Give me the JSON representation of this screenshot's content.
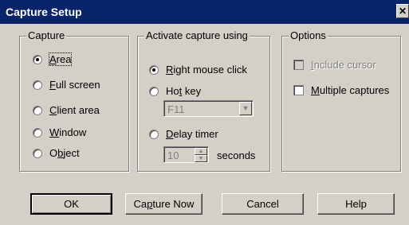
{
  "window": {
    "title": "Capture Setup",
    "close_glyph": "✕"
  },
  "capture_group": {
    "label": "Capture",
    "options": [
      {
        "pre": "",
        "key": "A",
        "post": "rea",
        "selected": true
      },
      {
        "pre": "",
        "key": "F",
        "post": "ull screen",
        "selected": false
      },
      {
        "pre": "",
        "key": "C",
        "post": "lient area",
        "selected": false
      },
      {
        "pre": "",
        "key": "W",
        "post": "indow",
        "selected": false
      },
      {
        "pre": "O",
        "key": "b",
        "post": "ject",
        "selected": false
      }
    ]
  },
  "activate_group": {
    "label": "Activate capture using",
    "right_click": {
      "pre": "",
      "key": "R",
      "post": "ight mouse click",
      "selected": true
    },
    "hot_key": {
      "pre": "Ho",
      "key": "t",
      "post": " key",
      "selected": false
    },
    "hot_key_value": "F11",
    "delay_timer": {
      "pre": "",
      "key": "D",
      "post": "elay timer",
      "selected": false
    },
    "delay_value": "10",
    "seconds_label": "seconds"
  },
  "options_group": {
    "label": "Options",
    "include_cursor": {
      "pre": "",
      "key": "I",
      "post": "nclude cursor",
      "checked": false,
      "enabled": false
    },
    "multiple_captures": {
      "pre": "",
      "key": "M",
      "post": "ultiple captures",
      "checked": false,
      "enabled": true
    }
  },
  "buttons": {
    "ok": "OK",
    "capture_now": {
      "pre": "Ca",
      "key": "p",
      "post": "ture Now"
    },
    "cancel": "Cancel",
    "help": "Help"
  },
  "icons": {
    "dropdown": "▼",
    "spin_up": "▲",
    "spin_down": "▼"
  }
}
